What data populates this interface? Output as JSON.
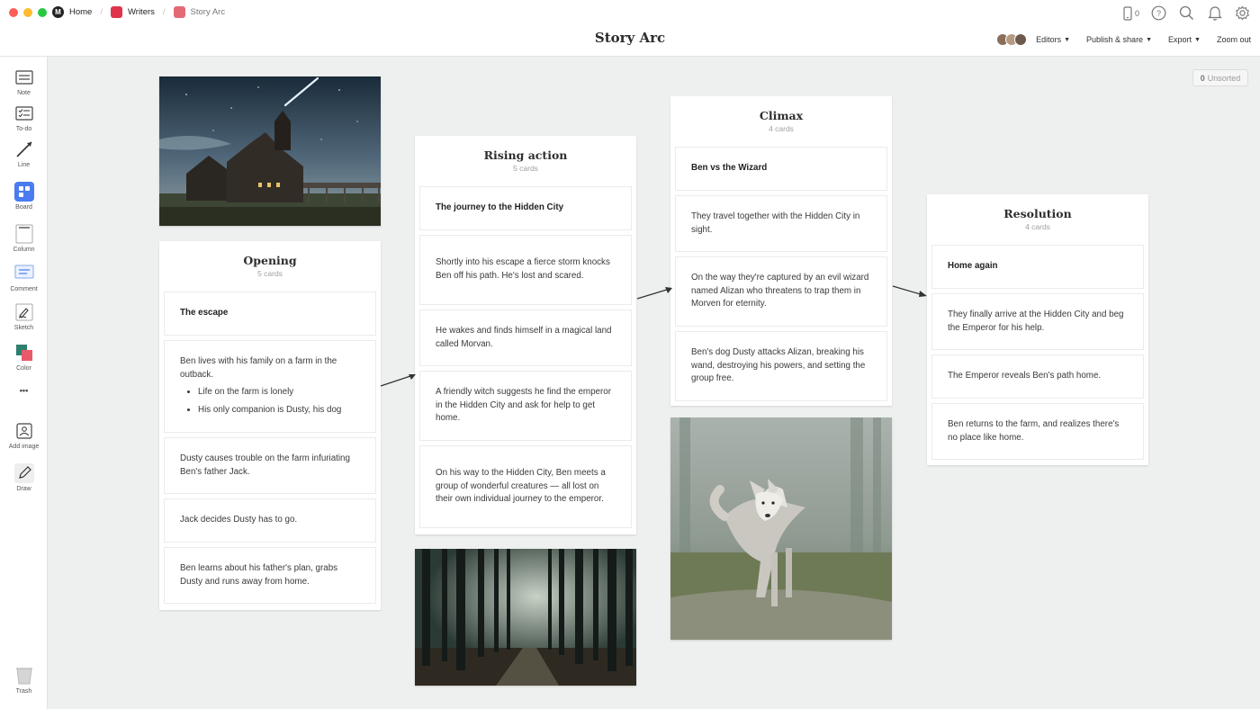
{
  "breadcrumbs": [
    {
      "label": "Home",
      "color": "#222222"
    },
    {
      "label": "Writers",
      "color": "#e0344c"
    },
    {
      "label": "Story Arc",
      "color": "#e36a75"
    }
  ],
  "title": "Story Arc",
  "top_icons": {
    "device_count": "0"
  },
  "toolbar": {
    "editors": "Editors",
    "publish": "Publish & share",
    "export": "Export",
    "zoom": "Zoom out"
  },
  "sidebar": {
    "note": "Note",
    "todo": "To-do",
    "line": "Line",
    "board": "Board",
    "column": "Column",
    "comment": "Comment",
    "sketch": "Sketch",
    "color": "Color",
    "more": "•••",
    "add_image": "Add image",
    "draw": "Draw",
    "trash": "Trash"
  },
  "unsorted": {
    "count": "0",
    "label": "Unsorted"
  },
  "columns": {
    "opening": {
      "title": "Opening",
      "count": "5 cards",
      "cards": [
        "The escape",
        "Ben lives with his family on a farm in the outback.",
        "Dusty causes trouble on the farm infuriating Ben's father Jack.",
        "Jack decides Dusty has to go.",
        "Ben learns about his father's plan, grabs Dusty and runs away from home."
      ],
      "bullets": [
        "Life on the farm is lonely",
        "His only companion is Dusty, his dog"
      ]
    },
    "rising": {
      "title": "Rising action",
      "count": "5 cards",
      "cards": [
        "The journey to the Hidden City",
        "Shortly into his escape a fierce storm knocks Ben off his path. He's lost and scared.",
        "He wakes and finds himself in a magical land called Morvan.",
        "A friendly witch suggests he find the emperor in the Hidden City and ask for help to get home.",
        "On his way to the Hidden City, Ben meets a group of wonderful creatures — all lost on their own individual journey to the emperor."
      ]
    },
    "climax": {
      "title": "Climax",
      "count": "4 cards",
      "cards": [
        "Ben vs the Wizard",
        "They travel together with the Hidden City in sight.",
        "On the way they're captured by an evil wizard named Alizan who threatens to trap them in Morven for eternity.",
        "Ben's dog Dusty attacks Alizan, breaking his wand, destroying his powers, and setting the group free."
      ]
    },
    "resolution": {
      "title": "Resolution",
      "count": "4 cards",
      "cards": [
        "Home again",
        "They finally arrive at the Hidden City and beg the Emperor for his help.",
        "The Emperor reveals Ben's path home.",
        "Ben returns to the farm, and realizes there's no place like home."
      ]
    }
  },
  "colors": {
    "accent_blue": "#4a7cf0",
    "close": "#fe5f57",
    "minimize": "#febc2e",
    "maximize": "#28c840"
  }
}
